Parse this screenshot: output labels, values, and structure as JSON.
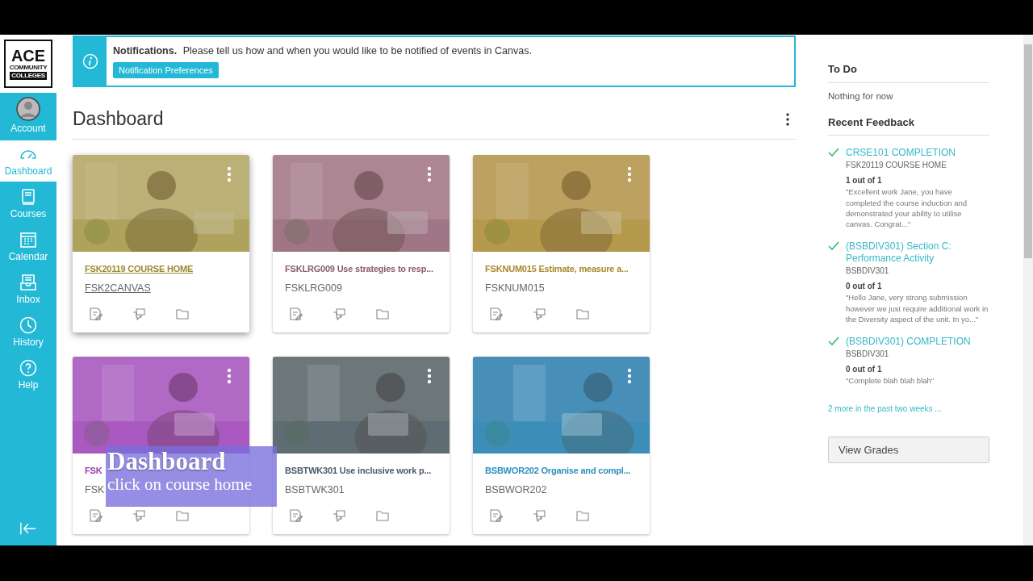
{
  "logo": {
    "title": "ACE",
    "line_1": "COMMUNITY",
    "line_2": "COLLEGES"
  },
  "nav": [
    {
      "label": "Account",
      "selected": false
    },
    {
      "label": "Dashboard",
      "selected": true
    },
    {
      "label": "Courses",
      "selected": false
    },
    {
      "label": "Calendar",
      "selected": false
    },
    {
      "label": "Inbox",
      "selected": false
    },
    {
      "label": "History",
      "selected": false
    },
    {
      "label": "Help",
      "selected": false
    }
  ],
  "notification": {
    "title": "Notifications.",
    "message": "Please tell us how and when you would like to be notified of events in Canvas.",
    "button": "Notification Preferences"
  },
  "page_title": "Dashboard",
  "cards": [
    {
      "title": "FSK20119 COURSE HOME",
      "code": "FSK2CANVAS",
      "color": "#9a8a2e",
      "hovered": true
    },
    {
      "title": "FSKLRG009 Use strategies to resp...",
      "code": "FSKLRG009",
      "color": "#8a5a72",
      "hovered": false
    },
    {
      "title": "FSKNUM015 Estimate, measure a...",
      "code": "FSKNUM015",
      "color": "#a8892c",
      "hovered": false
    },
    {
      "title": "FSK",
      "code": "FSK",
      "color": "#9b3bb5",
      "hovered": false
    },
    {
      "title": "BSBTWK301 Use inclusive work p...",
      "code": "BSBTWK301",
      "color": "#4a5a6a",
      "hovered": false
    },
    {
      "title": "BSBWOR202 Organise and compl...",
      "code": "BSBWOR202",
      "color": "#2a8fbd",
      "hovered": false
    }
  ],
  "caption": {
    "title": "Dashboard",
    "text": "click on course home"
  },
  "todo": {
    "heading": "To Do",
    "empty": "Nothing for now"
  },
  "feedback": {
    "heading": "Recent Feedback",
    "items": [
      {
        "title": "CRSE101 COMPLETION",
        "course": "FSK20119 COURSE HOME",
        "score": "1 out of 1",
        "comment": "\"Excellent work Jane, you have completed the course induction and demonstrated your ability to utilise canvas. Congrat...\""
      },
      {
        "title": "(BSBDIV301) Section C: Performance Activity",
        "course": "BSBDIV301",
        "score": "0 out of 1",
        "comment": "\"Hello Jane, very strong submission however we just require additional work in the Diversity aspect of the unit. In yo...\""
      },
      {
        "title": "(BSBDIV301) COMPLETION",
        "course": "BSBDIV301",
        "score": "0 out of 1",
        "comment": "\"Complete blah blah blah\""
      }
    ],
    "more": "2 more in the past two weeks ..."
  },
  "view_grades": "View Grades"
}
